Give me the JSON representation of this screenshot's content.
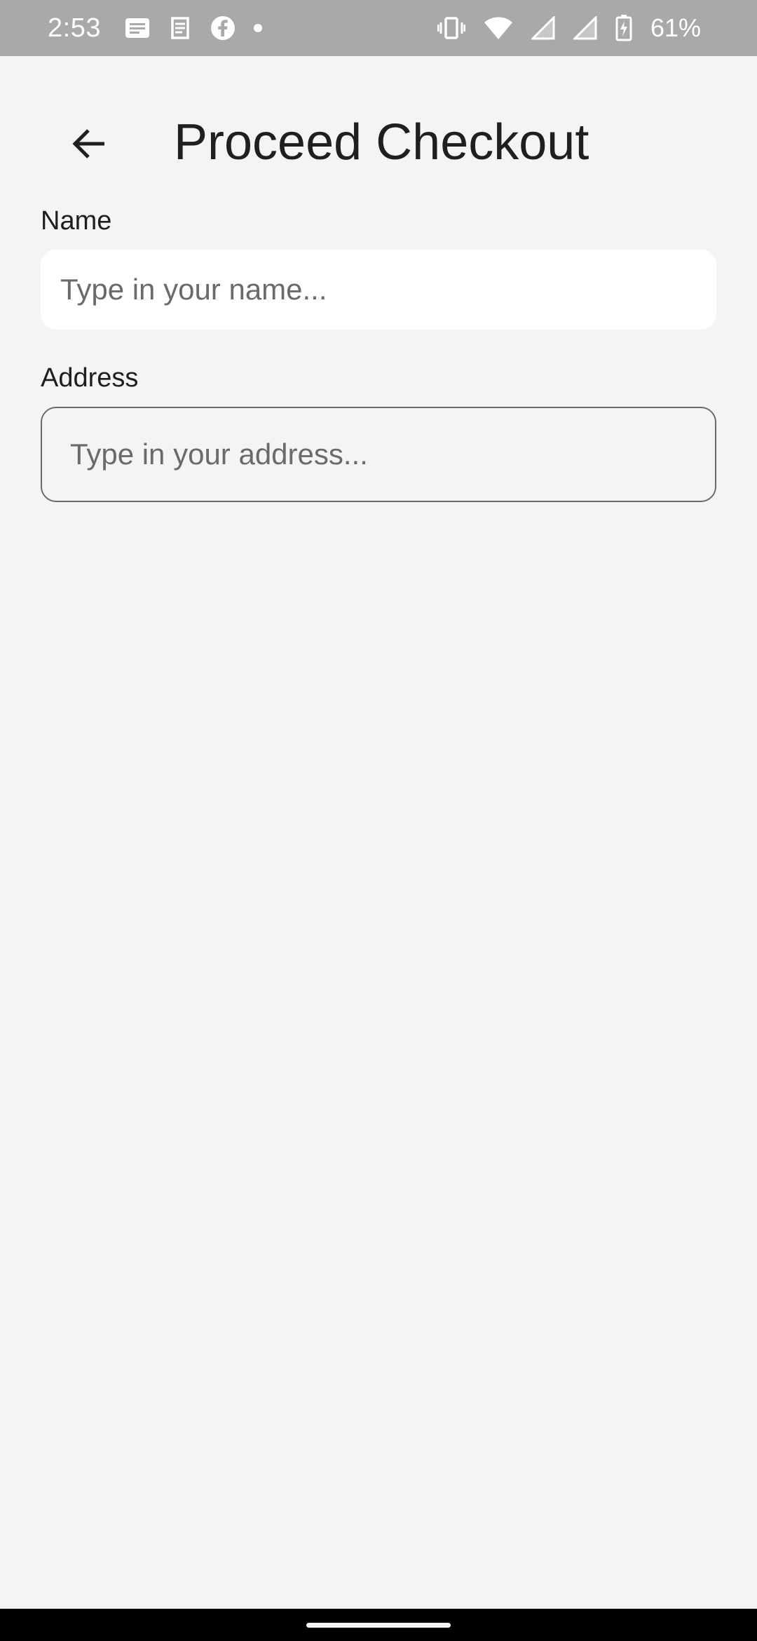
{
  "status_bar": {
    "time": "2:53",
    "battery_percent": "61%",
    "left_icons": [
      "message-notification-icon",
      "app-notification-icon",
      "facebook-icon",
      "more-notifications-dot-icon"
    ],
    "right_icons": [
      "vibrate-icon",
      "wifi-icon",
      "signal-icon",
      "signal-icon",
      "battery-charging-icon"
    ]
  },
  "app_bar": {
    "title": "Proceed Checkout",
    "back_icon": "arrow-back-icon"
  },
  "form": {
    "name": {
      "label": "Name",
      "value": "",
      "placeholder": "Type in your name..."
    },
    "address": {
      "label": "Address",
      "value": "",
      "placeholder": "Type in your address..."
    }
  },
  "colors": {
    "background": "#f4f4f4",
    "status_bar": "#a9a9a9",
    "name_field_fill": "#ffffff",
    "address_field_border": "#6b6b6b",
    "navigation_bar": "#000000"
  }
}
